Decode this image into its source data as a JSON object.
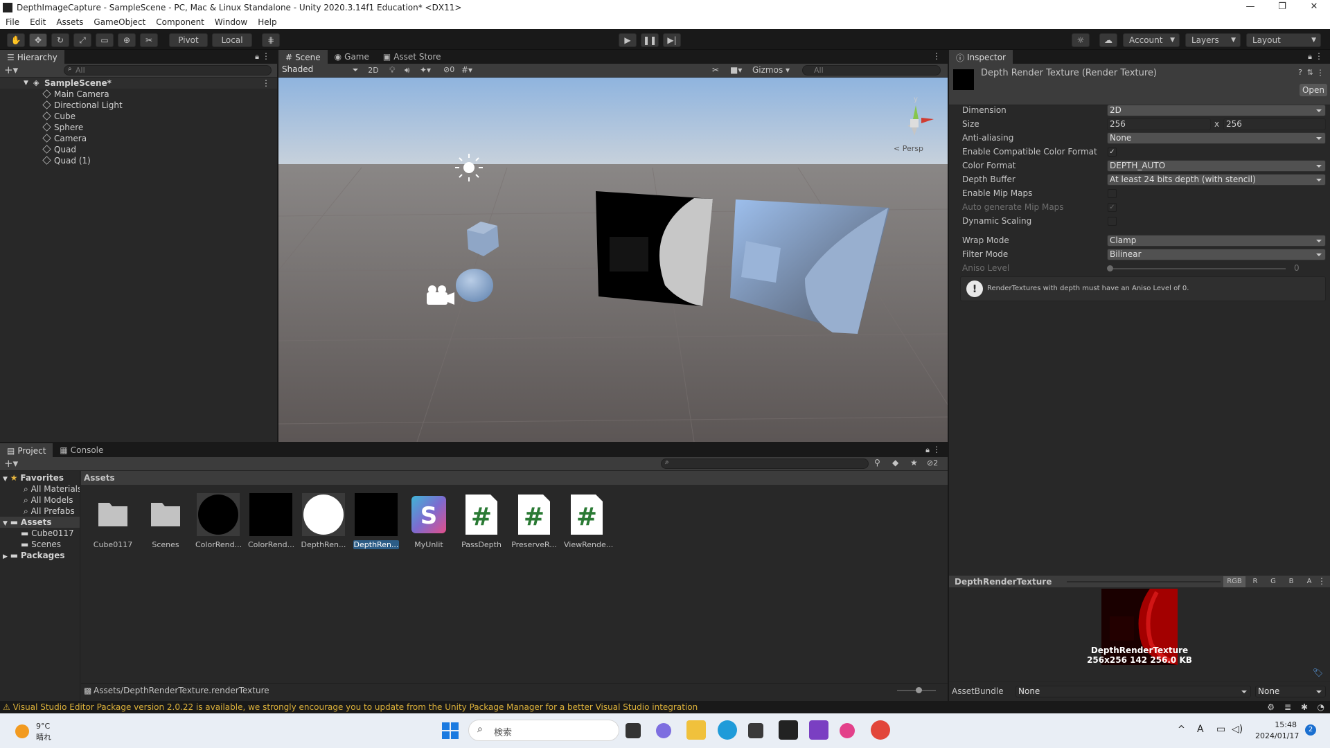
{
  "window": {
    "title": "DepthImageCapture - SampleScene - PC, Mac & Linux Standalone - Unity 2020.3.14f1 Education* <DX11>",
    "controls": [
      "—",
      "❐",
      "✕"
    ]
  },
  "menu": [
    "File",
    "Edit",
    "Assets",
    "GameObject",
    "Component",
    "Window",
    "Help"
  ],
  "toolbar": {
    "pivot": "Pivot",
    "local": "Local",
    "account": "Account",
    "layers": "Layers",
    "layout": "Layout"
  },
  "hierarchy": {
    "tab": "Hierarchy",
    "search_placeholder": "All",
    "scene": "SampleScene*",
    "items": [
      "Main Camera",
      "Directional Light",
      "Cube",
      "Sphere",
      "Camera",
      "Quad",
      "Quad (1)"
    ]
  },
  "scene": {
    "tabs": [
      "Scene",
      "Game",
      "Asset Store"
    ],
    "shading": "Shaded",
    "mode2d": "2D",
    "hidden_count": "0",
    "gizmos": "Gizmos",
    "search_placeholder": "All",
    "persp": "< Persp",
    "gizmo_y": "y"
  },
  "inspector": {
    "tab": "Inspector",
    "object_title": "Depth Render Texture (Render Texture)",
    "open_button": "Open",
    "props": {
      "dimension_label": "Dimension",
      "dimension": "2D",
      "size_label": "Size",
      "size_w": "256",
      "size_x": "x",
      "size_h": "256",
      "aa_label": "Anti-aliasing",
      "aa": "None",
      "compat_label": "Enable Compatible Color Format",
      "colorfmt_label": "Color Format",
      "colorfmt": "DEPTH_AUTO",
      "depth_label": "Depth Buffer",
      "depth": "At least 24 bits depth (with stencil)",
      "mips_label": "Enable Mip Maps",
      "automips_label": "Auto generate Mip Maps",
      "dynscale_label": "Dynamic Scaling",
      "wrap_label": "Wrap Mode",
      "wrap": "Clamp",
      "filter_label": "Filter Mode",
      "filter": "Bilinear",
      "aniso_label": "Aniso Level",
      "aniso": "0"
    },
    "warning": "RenderTextures with depth must have an Aniso Level of 0.",
    "preview": {
      "title": "DepthRenderTexture",
      "channels": [
        "RGB",
        "R",
        "G",
        "B",
        "A"
      ],
      "name": "DepthRenderTexture",
      "info": "256x256  142  256.0 KB"
    },
    "assetbundle_label": "AssetBundle",
    "assetbundle": "None",
    "variant": "None"
  },
  "project": {
    "tabs": [
      "Project",
      "Console"
    ],
    "favorites": "Favorites",
    "fav_items": [
      "All Materials",
      "All Models",
      "All Prefabs"
    ],
    "assets_root": "Assets",
    "asset_folders": [
      "Cube0117",
      "Scenes"
    ],
    "packages": "Packages",
    "breadcrumb": "Assets",
    "hidden_count": "2",
    "path": "Assets/DepthRenderTexture.renderTexture",
    "assets": [
      {
        "label": "Cube0117",
        "kind": "folder"
      },
      {
        "label": "Scenes",
        "kind": "folder"
      },
      {
        "label": "ColorRend...",
        "kind": "circle-black"
      },
      {
        "label": "ColorRend...",
        "kind": "black"
      },
      {
        "label": "DepthRen...",
        "kind": "circle-white"
      },
      {
        "label": "DepthRen...",
        "kind": "black-selected"
      },
      {
        "label": "MyUnlit",
        "kind": "shader"
      },
      {
        "label": "PassDepth",
        "kind": "script"
      },
      {
        "label": "PreserveR...",
        "kind": "script"
      },
      {
        "label": "ViewRende...",
        "kind": "script"
      }
    ]
  },
  "status": {
    "message": "Visual Studio Editor Package version 2.0.22 is available, we strongly encourage you to update from the Unity Package Manager for a better Visual Studio integration"
  },
  "taskbar": {
    "temp": "9°C",
    "weather": "晴れ",
    "search": "検索",
    "time": "15:48",
    "date": "2024/01/17",
    "ime": "A",
    "badge": "2"
  },
  "colors": {
    "accent": "#2c5d87",
    "selected": "#2c5d87",
    "warning": "#dcb13a"
  }
}
